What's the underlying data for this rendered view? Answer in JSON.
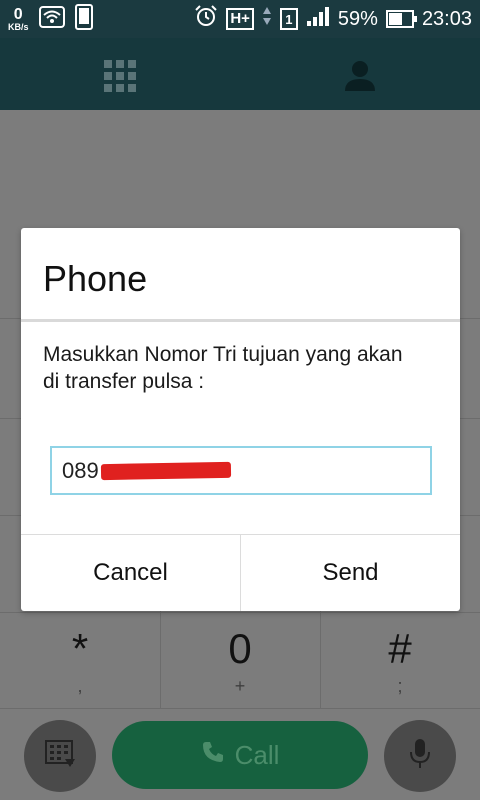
{
  "status_bar": {
    "net_speed_value": "0",
    "net_speed_unit": "KB/s",
    "network_type": "H+",
    "sim_slot": "1",
    "battery_percent": "59%",
    "battery_level": 0.59,
    "time": "23:03",
    "icons": [
      "wifi-icon",
      "phone-screen-icon",
      "alarm-icon",
      "data-arrows-icon",
      "signal-icon",
      "battery-icon"
    ]
  },
  "app_bar": {
    "tabs": [
      "dialpad-tab-icon",
      "contacts-tab-icon"
    ]
  },
  "dialog": {
    "title": "Phone",
    "message": "Masukkan Nomor Tri tujuan yang akan di transfer pulsa :",
    "input_value": "089",
    "cancel_label": "Cancel",
    "send_label": "Send",
    "accent_color": "#8fd3e6"
  },
  "keypad": {
    "keys": [
      {
        "main": "*",
        "sub": ","
      },
      {
        "main": "0",
        "sub": "+"
      },
      {
        "main": "#",
        "sub": ";"
      }
    ]
  },
  "bottom_bar": {
    "call_label": "Call",
    "call_color": "#16613f"
  }
}
